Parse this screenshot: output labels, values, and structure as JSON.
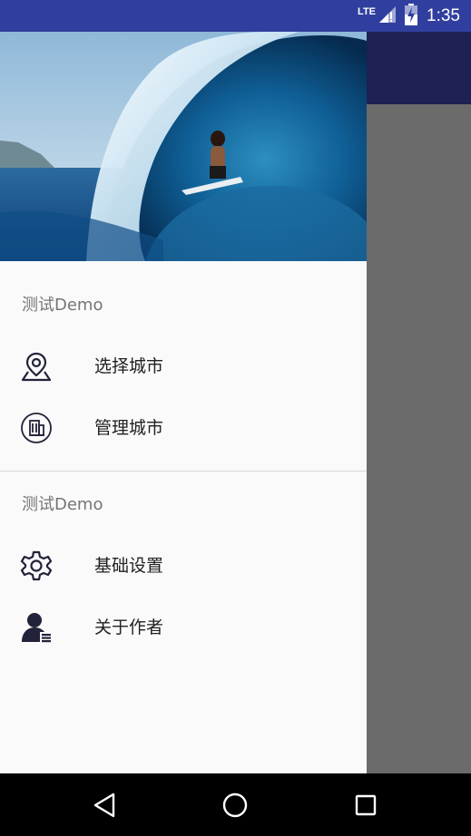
{
  "status_bar": {
    "network": "LTE",
    "time": "1:35"
  },
  "drawer": {
    "sections": [
      {
        "title": "测试Demo",
        "items": [
          {
            "label": "选择城市",
            "icon": "map-pin-icon"
          },
          {
            "label": "管理城市",
            "icon": "building-icon"
          }
        ]
      },
      {
        "title": "测试Demo",
        "items": [
          {
            "label": "基础设置",
            "icon": "gear-icon"
          },
          {
            "label": "关于作者",
            "icon": "user-list-icon"
          }
        ]
      }
    ]
  },
  "colors": {
    "status_bar": "#303f9f",
    "app_toolbar": "#1e2154",
    "scrim": "#6b6b6b",
    "drawer_bg": "#fafafa",
    "icon": "#22223a"
  },
  "nav_bar": {
    "buttons": [
      "back-icon",
      "home-icon",
      "recents-icon"
    ]
  }
}
